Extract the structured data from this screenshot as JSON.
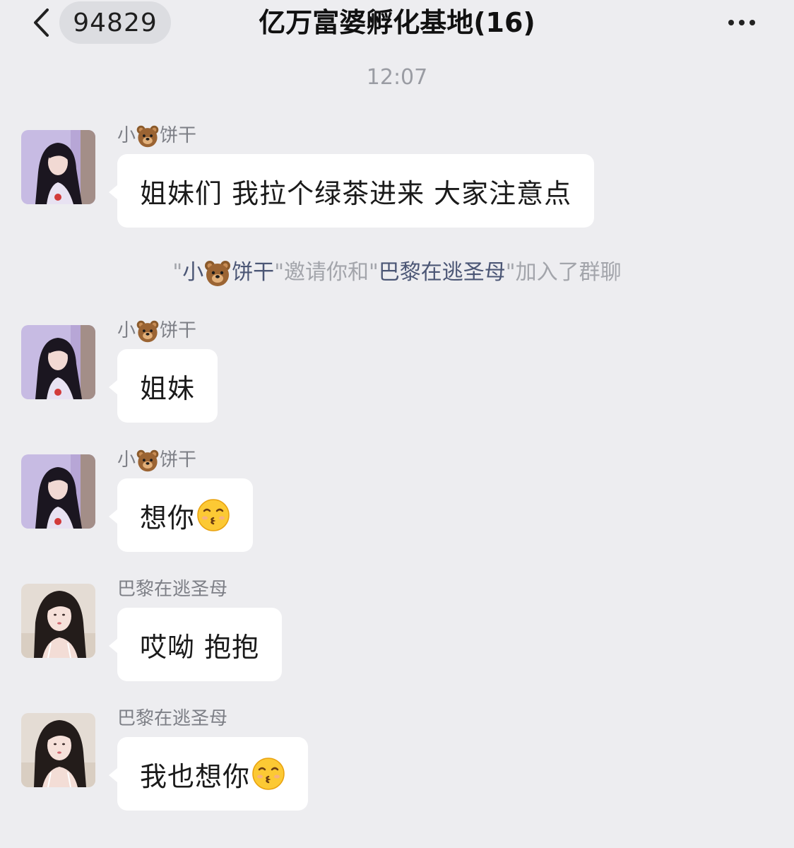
{
  "header": {
    "back_icon": "chevron-left-icon",
    "unread_count": "94829",
    "title": "亿万富婆孵化基地(16)",
    "more_icon": "more-dots-icon"
  },
  "timestamp": "12:07",
  "messages": [
    {
      "sender_prefix": "小",
      "sender_emoji": "bear-icon",
      "sender_suffix": "饼干",
      "text": "姐妹们 我拉个绿茶进来 大家注意点"
    },
    {
      "sender_prefix": "小",
      "sender_emoji": "bear-icon",
      "sender_suffix": "饼干",
      "text": "姐妹"
    },
    {
      "sender_prefix": "小",
      "sender_emoji": "bear-icon",
      "sender_suffix": "饼干",
      "text": "想你",
      "trailing_emoji": "kissing-face-icon"
    },
    {
      "sender": "巴黎在逃圣母",
      "text": "哎呦 抱抱"
    },
    {
      "sender": "巴黎在逃圣母",
      "text": "我也想你",
      "trailing_emoji": "kissing-face-icon"
    }
  ],
  "system_notice": {
    "q1": "\"",
    "inviter_prefix": "小",
    "inviter_suffix": "饼干",
    "mid": "\"邀请你和\"",
    "invitee": "巴黎在逃圣母",
    "end": "\"加入了群聊"
  },
  "colors": {
    "background": "#ededf0",
    "bubble": "#ffffff",
    "name_gray": "#7d7f86",
    "link": "#4b5675"
  }
}
